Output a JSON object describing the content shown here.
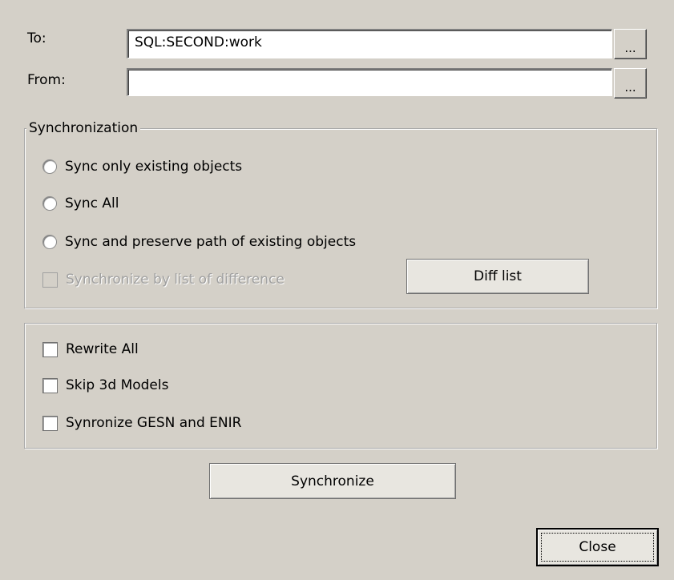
{
  "fields": {
    "to_label": "To:",
    "to_value": "SQL:SECOND:work",
    "from_label": "From:",
    "from_value": "",
    "browse_label": "..."
  },
  "sync_group": {
    "legend": "Synchronization",
    "options": [
      "Sync only existing objects",
      "Sync All",
      "Sync and preserve path of existing objects"
    ],
    "diff_checkbox_label": "Synchronize by list of difference",
    "diff_button_label": "Diff list"
  },
  "options_group": {
    "checkboxes": [
      "Rewrite All",
      "Skip 3d Models",
      "Synronize GESN and ENIR"
    ]
  },
  "actions": {
    "synchronize_label": "Synchronize",
    "close_label": "Close"
  }
}
